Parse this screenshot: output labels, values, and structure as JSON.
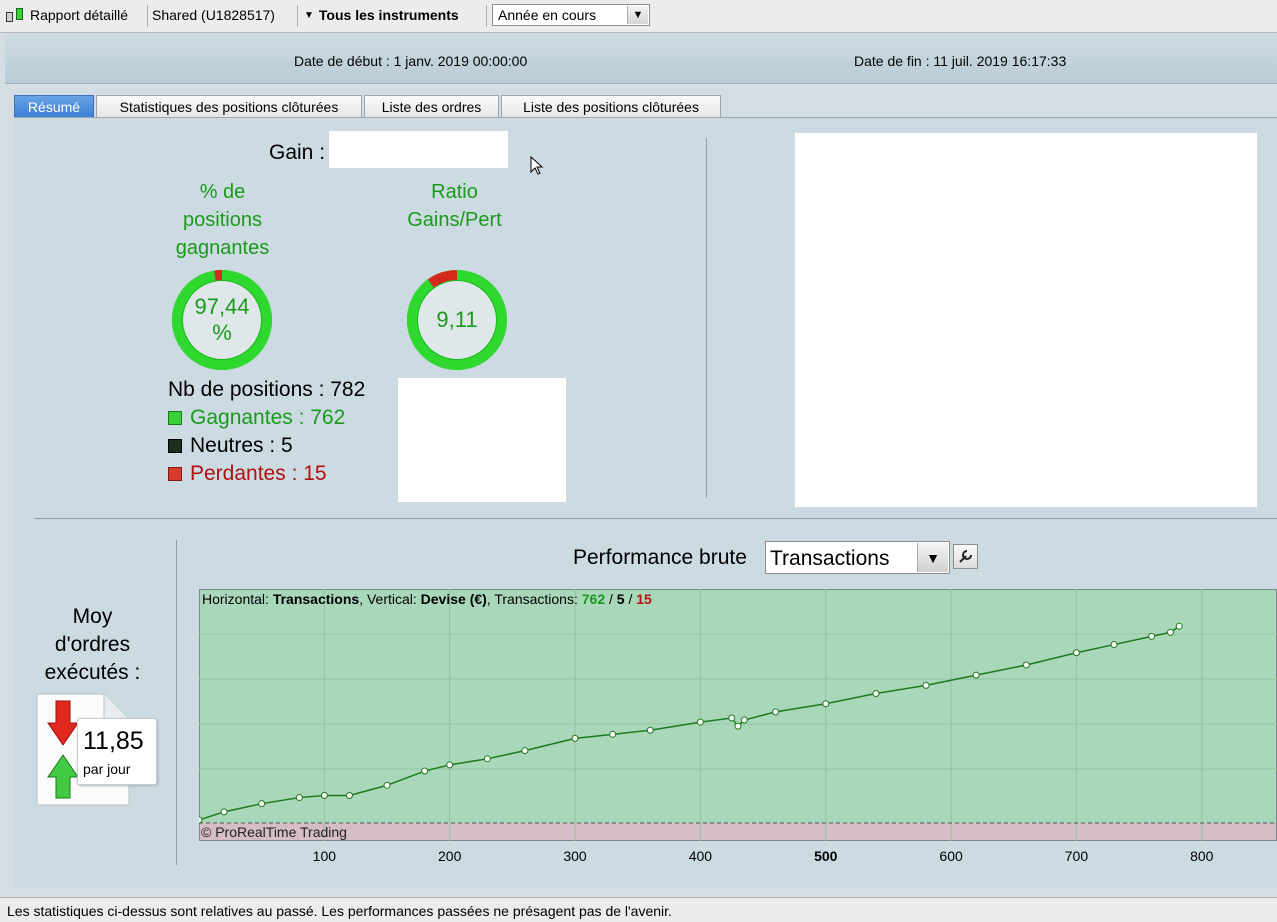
{
  "toolbar": {
    "report_label": "Rapport détaillé",
    "account_label": "Shared (U1828517)",
    "instruments_label": "Tous les instruments",
    "period_value": "Année en cours"
  },
  "header": {
    "start_date": "Date de début : 1 janv. 2019 00:00:00",
    "end_date": "Date de fin : 11 juil. 2019 16:17:33"
  },
  "tabs": [
    {
      "label": "Résumé",
      "active": true
    },
    {
      "label": "Statistiques des positions clôturées",
      "active": false
    },
    {
      "label": "Liste des ordres",
      "active": false
    },
    {
      "label": "Liste des positions clôturées",
      "active": false
    }
  ],
  "summary": {
    "gain_label": "Gain :",
    "win_pct_title_1": "% de",
    "win_pct_title_2": "positions",
    "win_pct_title_3": "gagnantes",
    "win_pct_value": "97,44",
    "win_pct_unit": "%",
    "win_pct_fraction": 0.9744,
    "ratio_title_1": "Ratio",
    "ratio_title_2": "Gains/Pert",
    "ratio_value": "9,11",
    "ratio_fraction": 0.9011,
    "positions_line": "Nb de positions : 782",
    "winners_line": "Gagnantes : 762",
    "neutral_line": "Neutres : 5",
    "losers_line": "Perdantes : 15"
  },
  "avg_orders": {
    "label_1": "Moy",
    "label_2": "d'ordres",
    "label_3": "exécutés :",
    "value": "11,85",
    "unit": "par jour"
  },
  "performance": {
    "title": "Performance brute",
    "selector_value": "Transactions",
    "info_prefix": "Horizontal: ",
    "info_h": "Transactions",
    "info_mid": ", Vertical: ",
    "info_v": "Devise (€)",
    "info_tx": ", Transactions: ",
    "info_win": "762",
    "info_sep1": " / ",
    "info_neutral": "5",
    "info_sep2": " / ",
    "info_loss": "15",
    "copyright": "© ProRealTime Trading"
  },
  "colors": {
    "win": "#1a9a1a",
    "loss": "#b01010",
    "chart_bg": "#a9d7b9",
    "chart_neg_bg": "#d6bcc4",
    "line": "#1f7a1f"
  },
  "chart_data": {
    "type": "line",
    "title": "Performance brute",
    "xlabel": "Transactions",
    "ylabel": "Devise (€)",
    "x_ticks": [
      100,
      200,
      300,
      400,
      500,
      600,
      700,
      800
    ],
    "xlim": [
      0,
      860
    ],
    "grid": true,
    "series": [
      {
        "x": [
          0,
          20,
          50,
          80,
          100,
          120,
          150,
          180,
          200,
          230,
          260,
          300,
          330,
          360,
          400,
          425,
          430,
          435,
          460,
          500,
          540,
          580,
          620,
          660,
          700,
          730,
          760,
          775,
          782
        ],
        "y": [
          0,
          4,
          8,
          11,
          12,
          12,
          17,
          24,
          27,
          30,
          34,
          40,
          42,
          44,
          48,
          50,
          46,
          49,
          53,
          57,
          62,
          66,
          71,
          76,
          82,
          86,
          90,
          92,
          95
        ]
      }
    ]
  },
  "footer": {
    "disclaimer": "Les statistiques ci-dessus sont relatives au passé. Les performances passées ne présagent pas de l'avenir."
  }
}
